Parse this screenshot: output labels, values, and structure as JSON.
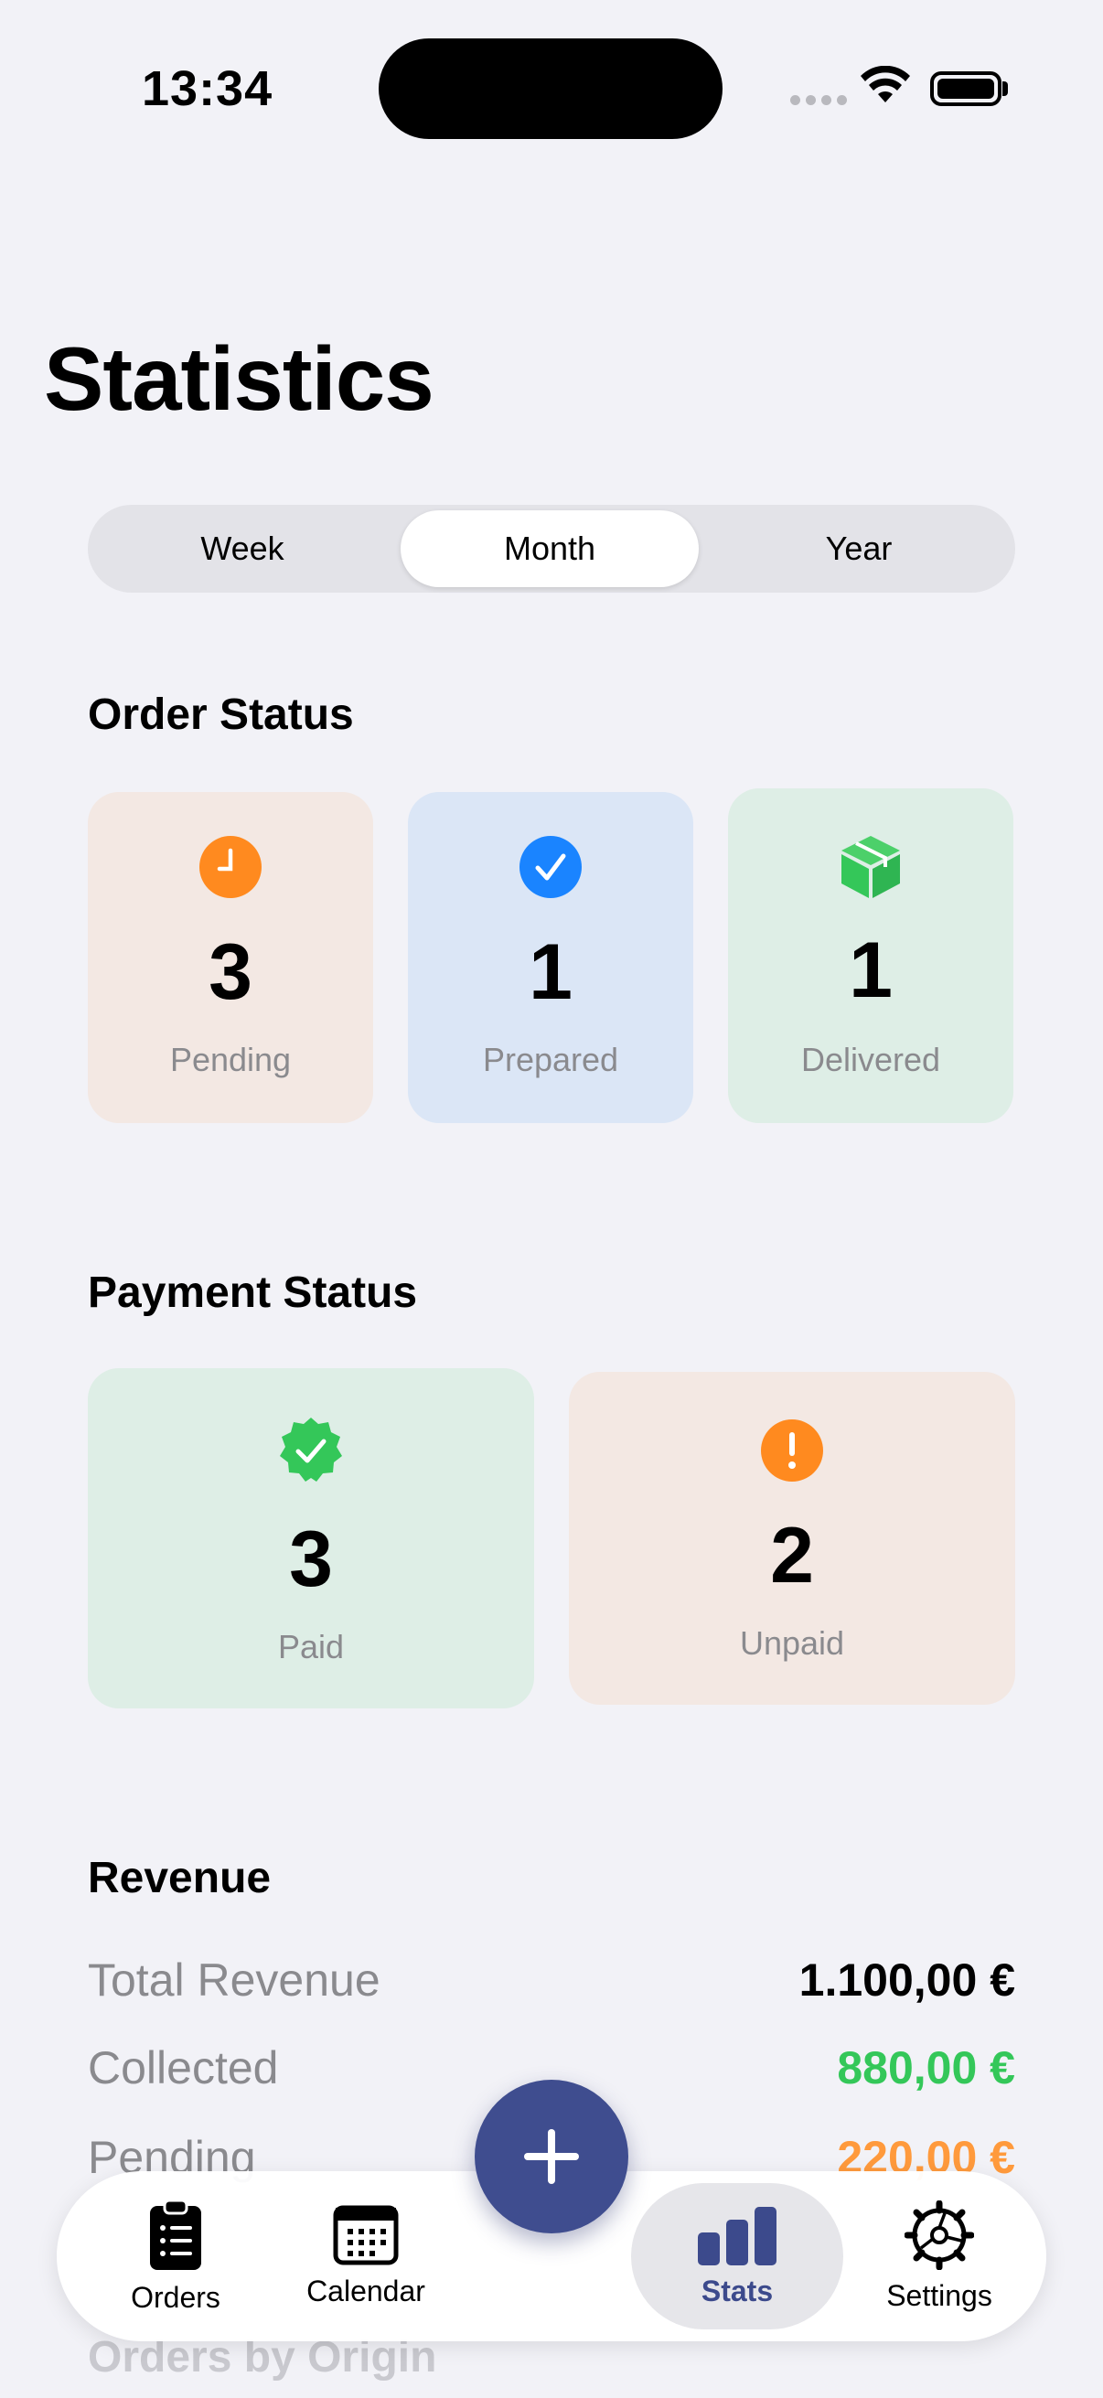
{
  "status_bar": {
    "time": "13:34"
  },
  "page": {
    "title": "Statistics"
  },
  "period": {
    "options": [
      "Week",
      "Month",
      "Year"
    ],
    "selected": "Month"
  },
  "order_status": {
    "title": "Order Status",
    "cards": [
      {
        "value": "3",
        "label": "Pending",
        "icon": "clock-icon",
        "color": "#ff8a1f",
        "bg": "#f3e8e3"
      },
      {
        "value": "1",
        "label": "Prepared",
        "icon": "checkmark-circle-icon",
        "color": "#1a84ff",
        "bg": "#dbe6f6"
      },
      {
        "value": "1",
        "label": "Delivered",
        "icon": "package-icon",
        "color": "#34c759",
        "bg": "#deeee6"
      }
    ]
  },
  "payment_status": {
    "title": "Payment Status",
    "cards": [
      {
        "value": "3",
        "label": "Paid",
        "icon": "verified-badge-icon",
        "color": "#34c759",
        "bg": "#deeee6"
      },
      {
        "value": "2",
        "label": "Unpaid",
        "icon": "exclamation-circle-icon",
        "color": "#ff8a1f",
        "bg": "#f3e8e3"
      }
    ]
  },
  "revenue": {
    "title": "Revenue",
    "rows": [
      {
        "label": "Total Revenue",
        "value": "1.100,00 €",
        "color": "#000000"
      },
      {
        "label": "Collected",
        "value": "880,00 €",
        "color": "#34c759"
      },
      {
        "label": "Pending",
        "value": "220,00 €",
        "color": "#ff9a3c"
      }
    ]
  },
  "next_section": {
    "title": "Orders by Origin"
  },
  "tabbar": {
    "items": [
      {
        "label": "Orders",
        "icon": "clipboard-list-icon"
      },
      {
        "label": "Calendar",
        "icon": "calendar-icon"
      },
      {
        "label": "Stats",
        "icon": "bar-chart-icon",
        "active": true
      },
      {
        "label": "Settings",
        "icon": "gear-icon"
      }
    ],
    "fab": {
      "icon": "plus-icon",
      "color": "#3f4d8f"
    }
  }
}
